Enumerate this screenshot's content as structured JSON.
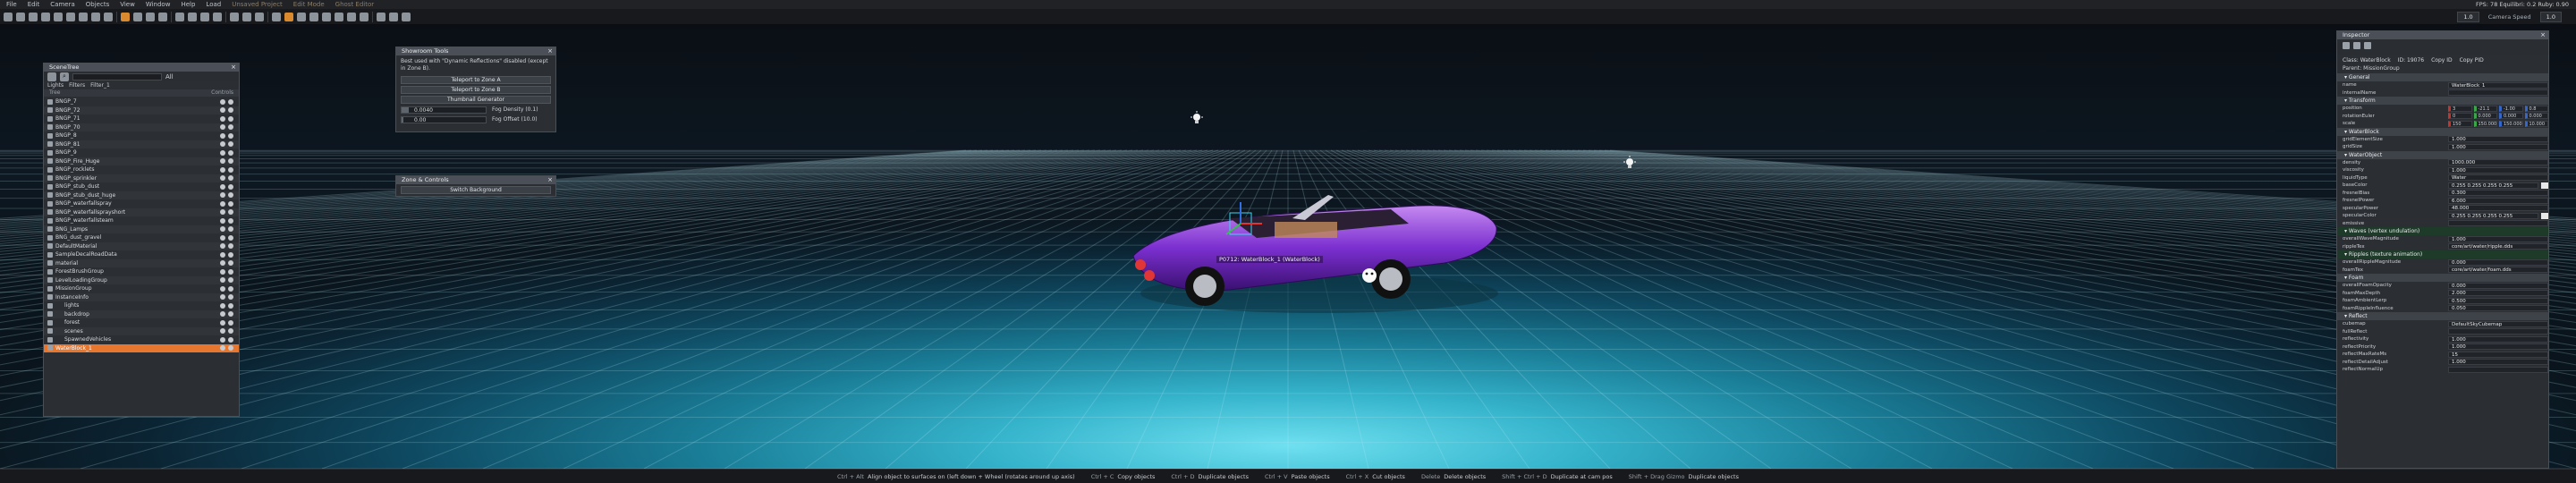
{
  "menubar": {
    "items": [
      "File",
      "Edit",
      "Camera",
      "Objects",
      "View",
      "Window",
      "Help",
      "Load"
    ],
    "sub_items": [
      "Unsaved Project",
      "Edit Mode",
      "Ghost Editor"
    ],
    "stats": "FPS: 78  Equilibri: 0.2  Ruby: 0.90"
  },
  "toolbar": {
    "camera_speed_label": "Camera Speed",
    "camera_speed_value": "1.0",
    "zoom_value": "1.0"
  },
  "scene_tree": {
    "title": "SceneTree",
    "filters": [
      "Lights",
      "Filters",
      "Filter_1"
    ],
    "search_placeholder": "All",
    "col_left": "Tree",
    "col_right": "Controls",
    "items": [
      "BNGP_7",
      "BNGP_72",
      "BNGP_71",
      "BNGP_70",
      "BNGP_8",
      "BNGP_81",
      "BNGP_9",
      "BNGP_Fire_Huge",
      "BNGP_rocklets",
      "BNGP_sprinkler",
      "BNGP_stub_dust",
      "BNGP_stub_dust_huge",
      "BNGP_waterfallspray",
      "BNGP_waterfallsprayshort",
      "BNGP_waterfallsteam",
      "BNG_Lamps",
      "BNG_dust_gravel",
      "DefaultMaterial",
      "SampleDecalRoadData",
      "material",
      "ForestBrushGroup",
      "LevelLoadingGroup",
      "MissionGroup",
      "InstanceInfo",
      "lights",
      "backdrop",
      "forest",
      "scenes",
      "SpawnedVehicles",
      "WaterBlock_1"
    ],
    "selected_index": 29
  },
  "generator": {
    "title": "Showroom Tools",
    "note": "Best used with \"Dynamic Reflections\" disabled (except in Zone B).",
    "buttons": [
      "Teleport to Zone A",
      "Teleport to Zone B",
      "Thumbnail Generator"
    ],
    "sliders": [
      {
        "label": "Fog Density (0.1)",
        "value": "0.0040",
        "fill": 0.08
      },
      {
        "label": "Fog Offset (10.0)",
        "value": "0.00",
        "fill": 0.02
      }
    ]
  },
  "zone": {
    "title": "Zone & Controls",
    "button": "Switch Background"
  },
  "viewport": {
    "car_label": "P0712: WaterBlock_1 (WaterBlock)"
  },
  "properties": {
    "title": "Inspector",
    "tabs": [
      "Class: WaterBlock",
      "ID: 19076",
      "Copy ID",
      "Copy PID"
    ],
    "parent": "Parent: MissionGroup",
    "sections": [
      {
        "name": "General",
        "rows": [
          [
            "name",
            "WaterBlock_1"
          ],
          [
            "internalName",
            ""
          ]
        ]
      },
      {
        "name": "Transform",
        "rows": [
          [
            "position",
            "3 | -21.1 | -1.00 | 0.8"
          ],
          [
            "rotationEuler",
            "0 | 0.000 | 0.000 | 0.000"
          ],
          [
            "scale",
            "150 | 150.000 | 150.000 | 10.000"
          ]
        ],
        "vec": true
      },
      {
        "name": "WaterBlock",
        "rows": [
          [
            "gridElementSize",
            "1.000"
          ],
          [
            "gridSize",
            "1.000"
          ]
        ]
      },
      {
        "name": "WaterObject",
        "rows": [
          [
            "density",
            "1000.000"
          ],
          [
            "viscosity",
            "1.000"
          ],
          [
            "liquidType",
            "Water"
          ],
          [
            "baseColor",
            "0.255  0.255  0.255  0.255"
          ],
          [
            "fresnelBias",
            "0.300"
          ],
          [
            "fresnelPower",
            "6.000"
          ],
          [
            "specularPower",
            "48.000"
          ],
          [
            "specularColor",
            "0.255  0.255  0.255  0.255"
          ],
          [
            "emissive",
            ""
          ]
        ]
      },
      {
        "name": "Waves (vertex undulation)",
        "green": true,
        "rows": [
          [
            "overallWaveMagnitude",
            "1.000"
          ],
          [
            "rippleTex",
            "core/art/water/ripple.dds"
          ]
        ]
      },
      {
        "name": "Ripples (texture animation)",
        "green": true,
        "rows": [
          [
            "overallRippleMagnitude",
            "0.000"
          ],
          [
            "foamTex",
            "core/art/water/foam.dds"
          ]
        ]
      },
      {
        "name": "Foam",
        "rows": [
          [
            "overallFoamOpacity",
            "0.000"
          ],
          [
            "foamMaxDepth",
            "2.000"
          ],
          [
            "foamAmbientLerp",
            "0.500"
          ],
          [
            "foamRippleInfluence",
            "0.050"
          ]
        ]
      },
      {
        "name": "Reflect",
        "rows": [
          [
            "cubemap",
            "DefaultSkyCubemap"
          ],
          [
            "fullReflect",
            ""
          ],
          [
            "reflectivity",
            "1.000"
          ],
          [
            "reflectPriority",
            "1.000"
          ],
          [
            "reflectMaxRateMs",
            "15"
          ],
          [
            "reflectDetailAdjust",
            "1.000"
          ],
          [
            "reflectNormalUp",
            ""
          ]
        ]
      }
    ]
  },
  "statusbar": [
    [
      "Ctrl + Alt",
      "Align object to surfaces on (left down + Wheel (rotates around up axis)"
    ],
    [
      "Ctrl + C",
      "Copy objects"
    ],
    [
      "Ctrl + D",
      "Duplicate objects"
    ],
    [
      "Ctrl + V",
      "Paste objects"
    ],
    [
      "Ctrl + X",
      "Cut objects"
    ],
    [
      "Delete",
      "Delete objects"
    ],
    [
      "Shift + Ctrl + D",
      "Duplicate at cam pos"
    ],
    [
      "Shift + Drag Gizmo",
      "Duplicate objects"
    ]
  ]
}
